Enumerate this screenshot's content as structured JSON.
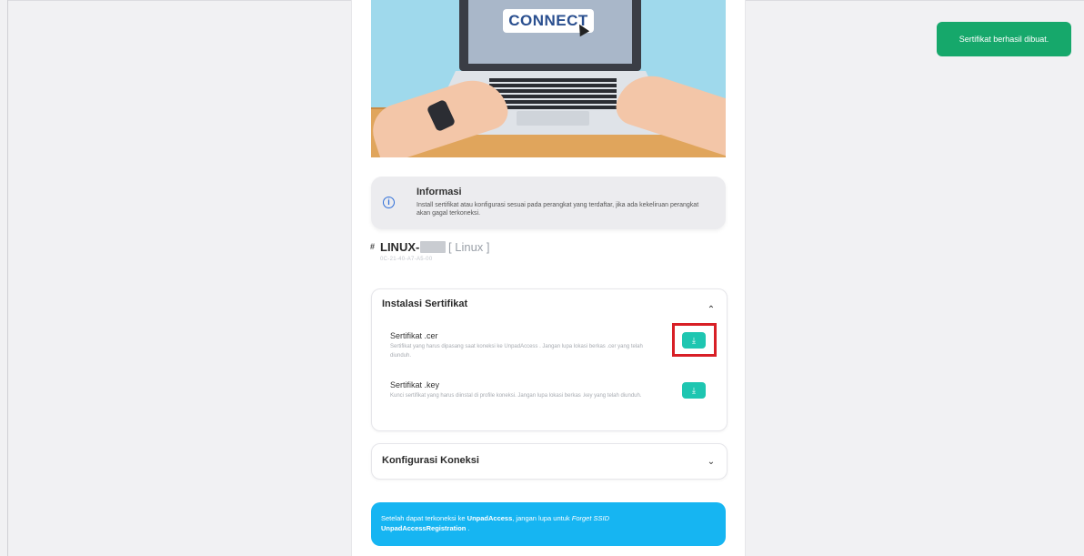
{
  "hero": {
    "connect_label": "CONNECT"
  },
  "info": {
    "icon": "info-icon",
    "icon_glyph": "i",
    "title": "Informasi",
    "text": "Install sertifikat atau konfigurasi sesuai pada perangkat yang terdaftar, jika ada kekeliruan perangkat akan gagal terkoneksi."
  },
  "device": {
    "hash": "#",
    "name": "LINUX-",
    "os": "[ Linux ]",
    "mac": "0C-21-40-A7-A5-00"
  },
  "cert_section": {
    "title": "Instalasi Sertifikat",
    "items": [
      {
        "title": "Sertifikat .cer",
        "desc": "Sertifikat yang harus dipasang saat koneksi ke UnpadAccess . Jangan lupa lokasi berkas .cer yang telah diunduh.",
        "button_icon": "download-icon",
        "button_glyph": "⤓"
      },
      {
        "title": "Sertifikat .key",
        "desc": "Kunci sertifikat yang harus diinstal di profile koneksi. Jangan lupa lokasi berkas .key yang telah diunduh.",
        "button_icon": "download-icon",
        "button_glyph": "⤓"
      }
    ],
    "chevron_glyph": "⌃"
  },
  "config_section": {
    "title": "Konfigurasi Koneksi",
    "chevron_glyph": "⌄"
  },
  "notice": {
    "prefix": "Setelah dapat terkoneksi ke ",
    "ssid": "UnpadAccess",
    "middle": ", jangan lupa untuk ",
    "action": "Forget SSID",
    "target": "UnpadAccessRegistration",
    "suffix": " ."
  },
  "toast": {
    "message": "Sertifikat berhasil dibuat."
  },
  "colors": {
    "accent_teal": "#1ec6b1",
    "notice_blue": "#16b5f2",
    "toast_green": "#16a86b",
    "highlight_red": "#d81f26"
  }
}
